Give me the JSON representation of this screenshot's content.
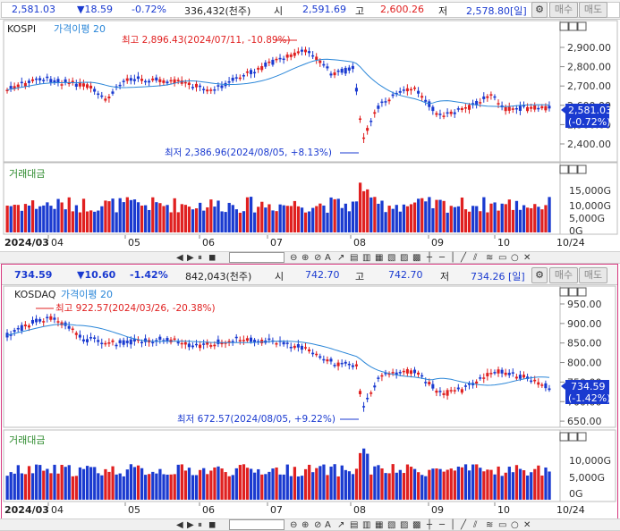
{
  "kospi": {
    "info": {
      "price": "2,581.03",
      "change": "▼18.59",
      "change_pct": "-0.72%",
      "volume": "336,432(천주)",
      "open_label": "시",
      "open": "2,591.69",
      "high_label": "고",
      "high": "2,600.26",
      "low_label": "저",
      "low": "2,578.80[일]"
    },
    "legend": {
      "name": "KOSPI",
      "ma": "가격이평 20"
    },
    "volume_legend": "거래대금",
    "annotations": {
      "high": "최고 2,896.43(2024/07/11, -10.89%)",
      "low": "최저 2,386.96(2024/08/05, +8.13%)"
    },
    "price_marker": {
      "price": "2,581.03",
      "pct": "(-0.72%)"
    },
    "y_ticks": [
      "2,900.00",
      "2,800.00",
      "2,700.00",
      "2,600.00",
      "2,500.00",
      "2,400.00"
    ],
    "vol_ticks": [
      "15,000G",
      "10,000G",
      "5,000G",
      "0G"
    ],
    "date_labels": [
      "2024/03",
      "04",
      "05",
      "06",
      "07",
      "08",
      "09",
      "10",
      "10/24"
    ]
  },
  "kosdaq": {
    "info": {
      "price": "734.59",
      "change": "▼10.60",
      "change_pct": "-1.42%",
      "volume": "842,043(천주)",
      "open_label": "시",
      "open": "742.70",
      "high_label": "고",
      "high": "742.70",
      "low_label": "저",
      "low": "734.26 [일]"
    },
    "legend": {
      "name": "KOSDAQ",
      "ma": "가격이평 20"
    },
    "volume_legend": "거래대금",
    "annotations": {
      "high": "최고 922.57(2024/03/26, -20.38%)",
      "low": "최저 672.57(2024/08/05, +9.22%)"
    },
    "price_marker": {
      "price": "734.59",
      "pct": "(-1.42%)"
    },
    "y_ticks": [
      "950.00",
      "900.00",
      "850.00",
      "800.00",
      "750.00",
      "700.00",
      "650.00"
    ],
    "vol_ticks": [
      "10,000G",
      "5,000G",
      "0G"
    ],
    "date_labels": [
      "2024/03",
      "04",
      "05",
      "06",
      "07",
      "08",
      "09",
      "10",
      "10/24"
    ]
  },
  "buttons": {
    "buy": "매수",
    "sell": "매도"
  },
  "colors": {
    "up": "#e02020",
    "down": "#1a3ad0",
    "ma": "#2a86d8",
    "price_box": "#1a3ad0",
    "frame": "#d7387f"
  },
  "icons": [
    "scale-lock-icon",
    "scale-reset-icon",
    "settings-gear-icon",
    "play-icon",
    "pause-icon",
    "stop-icon",
    "zoom-out-icon",
    "zoom-in-icon",
    "text-tool-icon",
    "crosshair-icon",
    "trend-line-icon",
    "delete-icon"
  ]
}
